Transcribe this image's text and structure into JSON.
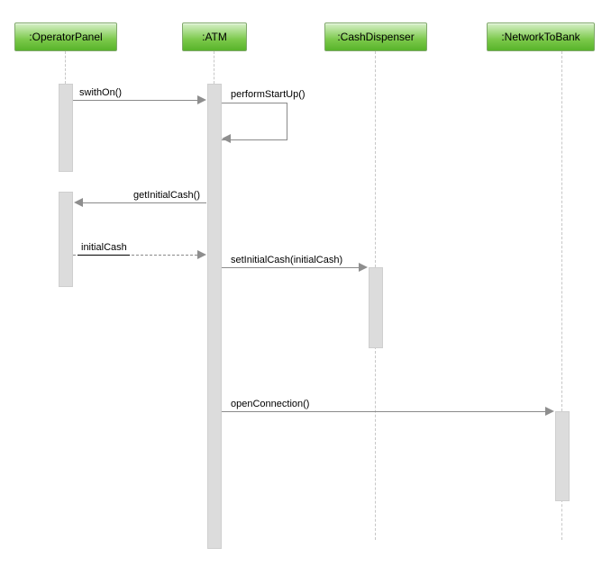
{
  "actors": {
    "operatorPanel": ":OperatorPanel",
    "atm": ":ATM",
    "cashDispenser": ":CashDispenser",
    "networkToBank": ":NetworkToBank"
  },
  "messages": {
    "switchOn": "swithOn()",
    "performStartUp": "performStartUp()",
    "getInitialCash": "getInitialCash()",
    "initialCash": "initialCash",
    "setInitialCash": "setInitialCash(initialCash)",
    "openConnection": "openConnection()"
  }
}
